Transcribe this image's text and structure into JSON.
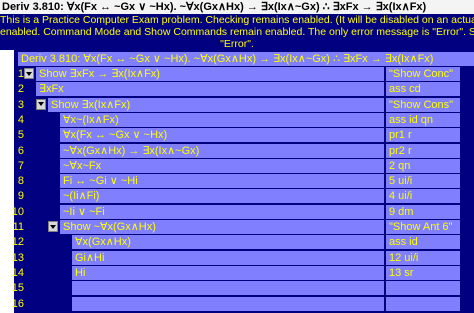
{
  "window": {
    "title": "Deriv 3.810: ∀x(Fx ↔ ~Gx ∨ ~Hx). ~∀x(Gx∧Hx) → ∃x(Ix∧~Gx) ∴ ∃xFx → ∃x(Ix∧Fx)"
  },
  "notice": {
    "line1": "This is a Practice Computer Exam problem.  Checking remains enabled.  (It will be disabled on an actual",
    "line2": "enabled.  Command Mode and Show Commands remain enabled.  The only error message is \"Error\".  Show li",
    "line3": "\"Error\"."
  },
  "header": {
    "text": "Deriv 3.810:  ∀x(Fx ↔ ~Gx ∨ ~Hx).  ~∀x(Gx∧Hx) → ∃x(Ix∧~Gx)  ∴  ∃xFx → ∃x(Ix∧Fx)"
  },
  "rows": [
    {
      "num": "1",
      "text": "Show  ∃xFx → ∃x(Ix∧Fx)",
      "just": "\"Show Conc\""
    },
    {
      "num": "2",
      "text": "∃xFx",
      "just": "ass cd"
    },
    {
      "num": "3",
      "text": "Show  ∃x(Ix∧Fx)",
      "just": "\"Show Cons\""
    },
    {
      "num": "4",
      "text": "∀x~(Ix∧Fx)",
      "just": "ass id qn"
    },
    {
      "num": "5",
      "text": "∀x(Fx ↔ ~Gx ∨ ~Hx)",
      "just": "pr1 r"
    },
    {
      "num": "6",
      "text": "~∀x(Gx∧Hx) → ∃x(Ix∧~Gx)",
      "just": "pr2 r"
    },
    {
      "num": "7",
      "text": "~∀x~Fx",
      "just": "2 qn"
    },
    {
      "num": "8",
      "text": "Fi ↔ ~Gi ∨ ~Hi",
      "just": "5 ui/i"
    },
    {
      "num": "9",
      "text": "~(Ii∧Fi)",
      "just": "4 ui/i"
    },
    {
      "num": "10",
      "text": "~Ii ∨ ~Fi",
      "just": "9 dm"
    },
    {
      "num": "11",
      "text": "Show  ~∀x(Gx∧Hx)",
      "just": "\"Show Ant 6\""
    },
    {
      "num": "12",
      "text": "∀x(Gx∧Hx)",
      "just": "ass id"
    },
    {
      "num": "13",
      "text": "Gi∧Hi",
      "just": "12 ui/i"
    },
    {
      "num": "14",
      "text": "Hi",
      "just": "13 sr"
    },
    {
      "num": "15",
      "text": "",
      "just": ""
    },
    {
      "num": "16",
      "text": "",
      "just": ""
    }
  ],
  "colors": {
    "navy": "#000080",
    "periwinkle": "#8080ff",
    "yellow": "#ffff00"
  }
}
